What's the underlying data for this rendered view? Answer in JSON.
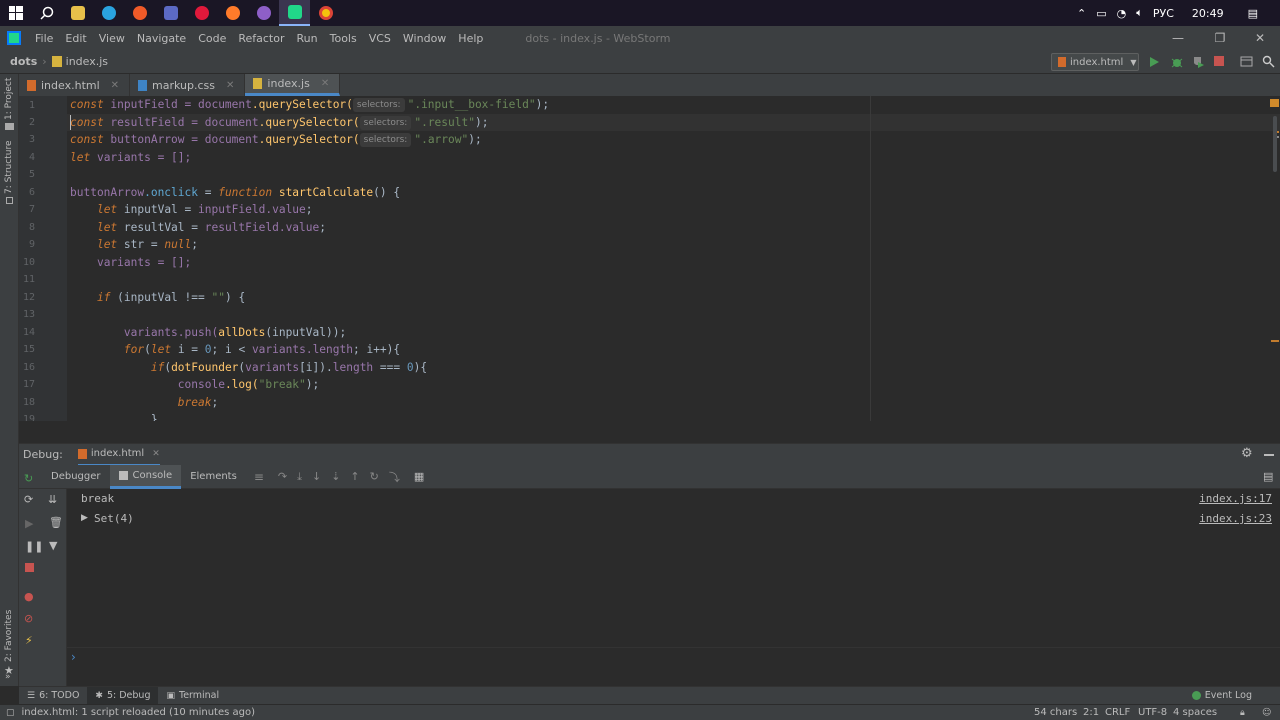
{
  "taskbar": {
    "time": "20:49",
    "language": "РУС",
    "apps": [
      "windows-start",
      "search",
      "file-explorer",
      "telegram",
      "media-player",
      "discord",
      "opera",
      "firefox",
      "app-purple",
      "webstorm",
      "chrome"
    ]
  },
  "menubar": {
    "items": [
      "File",
      "Edit",
      "View",
      "Navigate",
      "Code",
      "Refactor",
      "Run",
      "Tools",
      "VCS",
      "Window",
      "Help"
    ],
    "window_title": "dots - index.js - WebStorm"
  },
  "breadcrumb": {
    "project": "dots",
    "file": "index.js"
  },
  "run_config": "index.html",
  "left_strip": {
    "project": "1: Project",
    "structure": "7: Structure",
    "favorites": "2: Favorites"
  },
  "tabs": [
    {
      "label": "index.html"
    },
    {
      "label": "markup.css"
    },
    {
      "label": "index.js"
    }
  ],
  "editor": {
    "line_numbers": [
      "1",
      "2",
      "3",
      "4",
      "5",
      "6",
      "7",
      "8",
      "9",
      "10",
      "11",
      "12",
      "13",
      "14",
      "15",
      "16",
      "17",
      "18",
      "19"
    ],
    "hint_label": "selectors:",
    "line1": {
      "kw": "const",
      "name": " inputField = ",
      "obj": "document",
      "fn": ".querySelector(",
      "str": "\".input__box-field\"",
      "end": ");"
    },
    "line2": {
      "kw": "const",
      "name": " resultField = ",
      "obj": "document",
      "fn": ".querySelector(",
      "str": "\".result\"",
      "end": ");"
    },
    "line3": {
      "kw": "const",
      "name": " buttonArrow = ",
      "obj": "document",
      "fn": ".querySelector(",
      "str": "\".arrow\"",
      "end": ");"
    },
    "line4": {
      "kw": "let",
      "rest": " variants = [];"
    },
    "line6": {
      "a": "buttonArrow",
      "b": ".onclick",
      "c": " = ",
      "kw": "function",
      "fn": " startCalculate",
      "end": "() {"
    },
    "line7": {
      "kw": "let",
      "a": " inputVal = ",
      "b": "inputField",
      "c": ".value",
      "end": ";"
    },
    "line8": {
      "kw": "let",
      "a": " resultVal = ",
      "b": "resultField",
      "c": ".value",
      "end": ";"
    },
    "line9": {
      "kw": "let",
      "a": " str = ",
      "b": "null",
      "end": ";"
    },
    "line10": {
      "a": "variants = [];"
    },
    "line12": {
      "kw": "if",
      "a": " (inputVal !== ",
      "str": "\"\"",
      "end": ") {"
    },
    "line14": {
      "a": "variants",
      "b": ".push(",
      "fn": "allDots",
      "end": "(inputVal));"
    },
    "line15": {
      "kw": "for",
      "a": "(",
      "kw2": "let",
      "b": " i = ",
      "num": "0",
      "c": "; i < ",
      "d": "variants",
      "e": ".length",
      "end": "; i++){"
    },
    "line16": {
      "kw": "if",
      "a": "(",
      "fn": "dotFounder",
      "b": "(",
      "c": "variants",
      "d": "[i]).",
      "e": "length",
      "f": " === ",
      "num": "0",
      "end": "){"
    },
    "line17": {
      "a": "console",
      "b": ".log(",
      "str": "\"break\"",
      "end": ");"
    },
    "line18": {
      "kw": "break",
      "end": ";"
    },
    "line19": {
      "a": "}"
    }
  },
  "debug": {
    "label": "Debug:",
    "session": "index.html",
    "tabs": [
      "Debugger",
      "Console",
      "Elements"
    ],
    "console_lines": [
      {
        "text": "break",
        "source": "index.js:17"
      },
      {
        "text": "Set(4)",
        "source": "index.js:23"
      }
    ],
    "prompt": "›"
  },
  "bottom_tools": {
    "todo": "6: TODO",
    "debug": "5: Debug",
    "terminal": "Terminal",
    "event_log": "Event Log"
  },
  "status": {
    "message": "index.html: 1 script reloaded (10 minutes ago)",
    "chars": "54 chars",
    "position": "2:1",
    "line_sep": "CRLF",
    "encoding": "UTF-8",
    "indent": "4 spaces"
  },
  "colors": {
    "accent": "#4a88c7",
    "run_green": "#499c54",
    "stop_red": "#c75450"
  }
}
